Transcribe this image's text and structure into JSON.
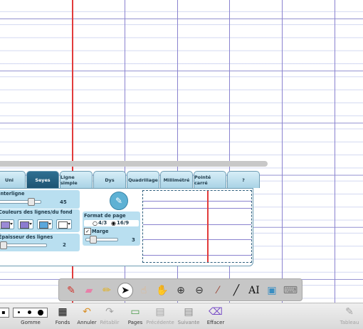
{
  "settings_panel": {
    "tabs": [
      {
        "label": "Uni",
        "active": false
      },
      {
        "label": "Seyes",
        "active": true
      },
      {
        "label": "Ligne simple",
        "active": false
      },
      {
        "label": "Dys",
        "active": false
      },
      {
        "label": "Quadrillage",
        "active": false
      },
      {
        "label": "Millimétré",
        "active": false
      },
      {
        "label": "Pointé carré",
        "active": false
      },
      {
        "label": "?",
        "active": false
      }
    ],
    "interligne": {
      "label": "Interligne",
      "value": "45"
    },
    "couleurs": {
      "label": "Couleurs des lignes/du fond",
      "swatches": [
        "#9b8ad6",
        "#8b7bd0",
        "#5aa7dc",
        "#ffffff"
      ]
    },
    "epaisseur": {
      "label": "Épaisseur des lignes",
      "value": "2"
    },
    "format": {
      "label": "Format de page",
      "option_a": "4/3",
      "option_b": "16/9",
      "selected": "16/9"
    },
    "marge": {
      "label": "Marge",
      "checked": true,
      "value": "3"
    }
  },
  "toolbar": {
    "tools": [
      "pen-icon",
      "eraser-icon",
      "highlighter-icon",
      "pointer-icon",
      "hand-icon",
      "grab-icon",
      "zoom-in-icon",
      "zoom-out-icon",
      "pipette-icon",
      "line-icon",
      "text-icon",
      "screen-capture-icon",
      "keyboard-icon"
    ],
    "selected": "pointer-icon"
  },
  "bottom_bar": {
    "gomme": {
      "label": "Gomme"
    },
    "fonds": {
      "label": "Fonds"
    },
    "annuler": {
      "label": "Annuler"
    },
    "retablir": {
      "label": "Rétablir"
    },
    "pages": {
      "label": "Pages"
    },
    "precedente": {
      "label": "Précédente"
    },
    "suivante": {
      "label": "Suivante"
    },
    "effacer": {
      "label": "Effacer"
    },
    "tableau": {
      "label": "Tableau"
    }
  },
  "colors": {
    "accent": "#1e5473",
    "margin_line": "#e23b3b",
    "grid_line": "#8a82cf",
    "panel_bg": "#b9dff0"
  }
}
